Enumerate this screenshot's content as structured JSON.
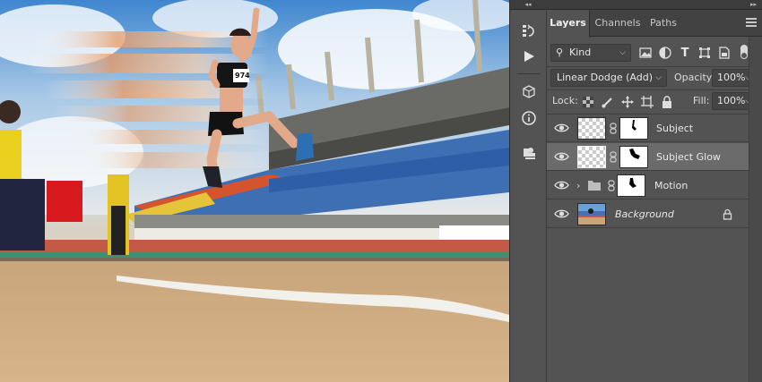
{
  "panel": {
    "tabs": [
      {
        "label": "Layers"
      },
      {
        "label": "Channels"
      },
      {
        "label": "Paths"
      }
    ],
    "filter": {
      "label": "Kind"
    },
    "blend_mode": "Linear Dodge (Add)",
    "opacity": {
      "label": "Opacity:",
      "value": "100%"
    },
    "lock": {
      "label": "Lock:"
    },
    "fill": {
      "label": "Fill:",
      "value": "100%"
    },
    "layers": [
      {
        "name": "Subject"
      },
      {
        "name": "Subject Glow"
      },
      {
        "name": "Motion"
      },
      {
        "name": "Background"
      }
    ]
  },
  "canvas": {
    "bib_number": "974"
  },
  "colors": {
    "panel_bg": "#535353",
    "selected_row": "#6b6b6b",
    "tab_bar": "#424242"
  },
  "icons": [
    "search-icon",
    "image-filter-icon",
    "adjustment-filter-icon",
    "type-filter-icon",
    "shape-filter-icon",
    "smart-object-filter-icon",
    "filter-toggle-icon",
    "history-icon",
    "play-icon",
    "3d-icon",
    "info-icon",
    "stamp-icon",
    "eye-icon",
    "link-icon",
    "folder-icon",
    "lock-icon",
    "panel-menu-icon"
  ]
}
